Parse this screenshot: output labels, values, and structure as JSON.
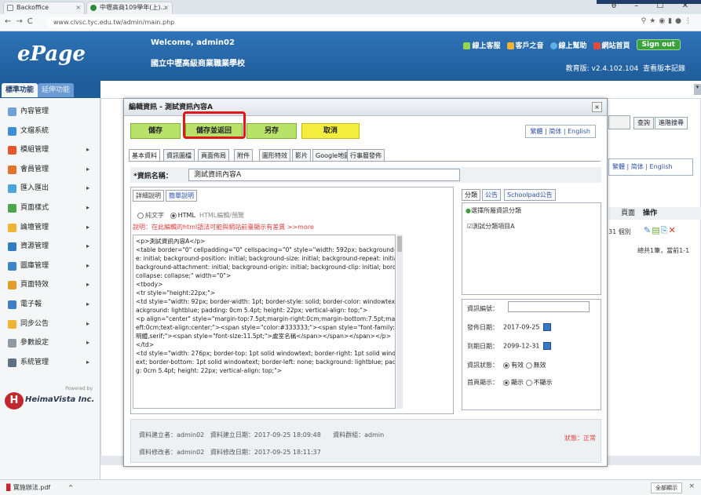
{
  "browser": {
    "tabs": [
      {
        "label": "Backoffice"
      },
      {
        "label": "中壢高商109學年(上)..."
      }
    ],
    "url": "www.clvsc.tyc.edu.tw/admin/main.php",
    "window_controls": "ᵔθ – ☐ ✕"
  },
  "header": {
    "logo": "ePage",
    "welcome": "Welcome, admin02",
    "school": "國立中壢高級商業職業學校",
    "links": [
      "線上客服",
      "客戶之音",
      "線上幫助",
      "網站首頁"
    ],
    "signout": "Sign out",
    "version": "教育版: v2.4.102.104",
    "version_link": "查看版本記錄"
  },
  "sidebar": {
    "tabs": [
      "標準功能",
      "延伸功能"
    ],
    "items": [
      {
        "label": "內容管理",
        "icon": "content-icon",
        "color": "#6fa1d6"
      },
      {
        "label": "文檔系統",
        "icon": "document-icon",
        "color": "#3d8ed8"
      },
      {
        "label": "模組管理",
        "icon": "module-icon",
        "color": "#e5542b"
      },
      {
        "label": "會員管理",
        "icon": "member-icon",
        "color": "#e2732a"
      },
      {
        "label": "匯入匯出",
        "icon": "import-export-icon",
        "color": "#4aa5d9"
      },
      {
        "label": "頁面樣式",
        "icon": "style-icon",
        "color": "#4aa54a"
      },
      {
        "label": "論壇管理",
        "icon": "forum-icon",
        "color": "#f2b233"
      },
      {
        "label": "資源管理",
        "icon": "resource-icon",
        "color": "#2f7cc3"
      },
      {
        "label": "圖庫管理",
        "icon": "gallery-icon",
        "color": "#3a86c9"
      },
      {
        "label": "頁面特效",
        "icon": "effect-icon",
        "color": "#e59d2a"
      },
      {
        "label": "電子報",
        "icon": "newsletter-icon",
        "color": "#3f7fc6"
      },
      {
        "label": "同步公告",
        "icon": "sync-icon",
        "color": "#f2b233"
      },
      {
        "label": "參數設定",
        "icon": "settings-icon",
        "color": "#8f98a3"
      },
      {
        "label": "系統管理",
        "icon": "system-icon",
        "color": "#5f6f84"
      }
    ],
    "powered_by": "Powered by",
    "company": "HeimaVista Inc."
  },
  "background": {
    "query_btn": "查詢",
    "advanced_btn": "進階搜尋",
    "lang": "繁體 | 简体 | English",
    "col_page": "頁面",
    "col_action": "操作",
    "count": "31 個別",
    "pager": "總共1筆，當前1-1"
  },
  "modal": {
    "title": "編輯資訊 - 測試資訊內容A",
    "buttons": [
      "儲存",
      "儲存並返回",
      "另存",
      "取消"
    ],
    "lang": "繁體 | 简体 | English",
    "tabs": [
      "基本資料",
      "資訊圖檔",
      "頁面佈局",
      "附件",
      "圖形特效",
      "影片",
      "Google地圖",
      "行事曆發佈"
    ],
    "title_label": "*資訊名稱：",
    "title_value": "測試資訊內容A",
    "editor_tabs": [
      "詳細說明",
      "簡單說明"
    ],
    "radio_plain": "純文字",
    "radio_html": "HTML",
    "radio_html_extra": "HTML編輯/預覽",
    "hint": "說明：在此編輯的html語法可能與網站前臺顯示有差異 >>more",
    "code_lines": [
      "<p>測試資訊內容A</p>",
      "<table border=\"0\" cellpadding=\"0\" cellspacing=\"0\" style=\"width: 592px; background-imag",
      "e: initial; background-position: initial; background-size: initial; background-repeat: initial;",
      " background-attachment: initial; background-origin: initial; background-clip: initial; border-",
      "collapse: collapse;\" width=\"0\">",
      "<tbody>",
      "<tr style=\"height:22px;\">",
      "<td style=\"width: 92px; border-width: 1pt; border-style: solid; border-color: windowtext; b",
      "ackground: lightblue; padding: 0cm 5.4pt; height: 22px; vertical-align: top;\">",
      "<p align=\"center\" style=\"margin-top:7.5pt;margin-right:0cm;margin-bottom:7.5pt;margin-l",
      "eft:0cm;text-align:center;\"><span style=\"color:#333333;\"><span style=\"font-family:新細",
      "明體,serif;\"><span style=\"font-size:11.5pt;\">處室名稱</span></span></span></p>",
      "</td>",
      "<td style=\"width: 276px; border-top: 1pt solid windowtext; border-right: 1pt solid windowt",
      "ext; border-bottom: 1pt solid windowtext; border-left: none; background: lightblue; paddin",
      "g: 0cm 5.4pt; height: 22px; vertical-align: top;\">"
    ],
    "right_tabs": [
      "分類",
      "公告",
      "Schoolpad公告"
    ],
    "cat_label": "選擇所屬資訊分類",
    "cat_item": "測試分類項目A",
    "serial_label": "資訊編號：",
    "publish_label": "發佈日期：",
    "publish_date": "2017-09-25",
    "expire_label": "到期日期：",
    "expire_date": "2099-12-31",
    "state_label": "資訊狀態：",
    "state_on": "有效",
    "state_off": "無效",
    "home_label": "首頁顯示：",
    "home_on": "顯示",
    "home_off": "不顯示",
    "creator": "資料建立者：admin02",
    "created": "資料建立日期：2017-09-25 18:09:48",
    "group": "資料群組：admin",
    "modifier": "資料修改者：admin02",
    "modified": "資料修改日期：2017-09-25 18:11:37",
    "status": "狀態：正常"
  },
  "downloads": {
    "file": "實施辦法.pdf",
    "show_all": "全部顯示"
  }
}
